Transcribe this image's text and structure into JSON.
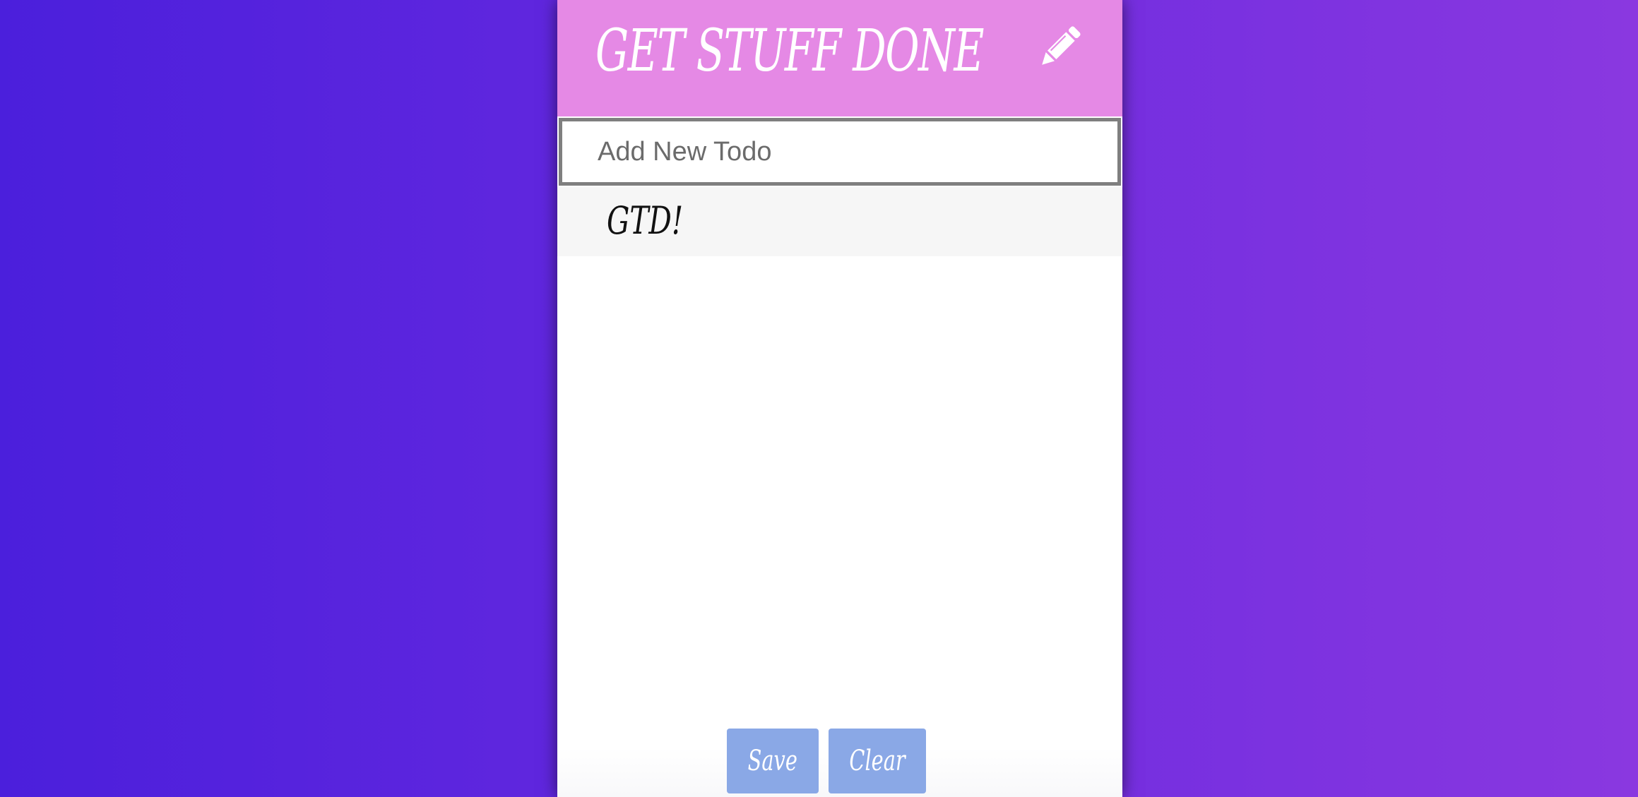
{
  "header": {
    "title": "GET STUFF DONE",
    "icon": "pencil-icon",
    "background": "#e589e5"
  },
  "input": {
    "placeholder": "Add New Todo",
    "value": ""
  },
  "todos": [
    {
      "text": "GTD!"
    }
  ],
  "buttons": {
    "save_label": "Save",
    "clear_label": "Clear",
    "color": "#8aa8e6"
  },
  "colors": {
    "background_start": "#4b1fdc",
    "background_end": "#8a38e0"
  }
}
